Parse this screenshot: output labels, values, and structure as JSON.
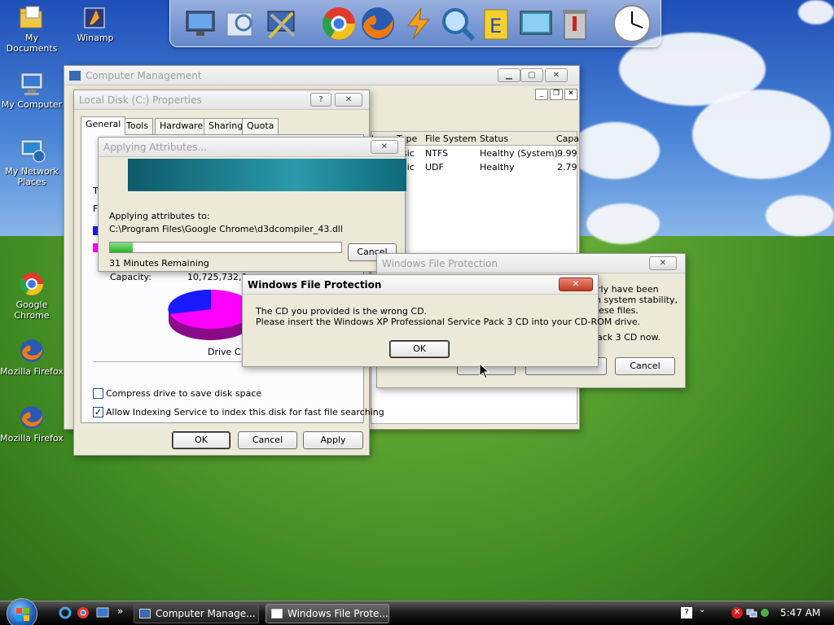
{
  "desktop": {
    "icons": [
      {
        "label": "My Documents"
      },
      {
        "label": "Winamp"
      },
      {
        "label": "My Computer"
      },
      {
        "label": "My Network Places"
      },
      {
        "label": "Google Chrome"
      },
      {
        "label": "Mozilla Firefox"
      },
      {
        "label": "Mozilla Firefox"
      }
    ]
  },
  "dock": {
    "items": [
      "monitor-icon",
      "search-docs-icon",
      "tools-icon",
      "chrome-icon",
      "firefox-icon",
      "winamp-icon",
      "search-icon",
      "file-icon",
      "display-icon",
      "trash-icon",
      "clock-icon"
    ]
  },
  "computer_management": {
    "title": "Computer Management",
    "columns": [
      "t",
      "Type",
      "File System",
      "Status",
      "Capa"
    ],
    "rows": [
      {
        "type": "sic",
        "fs": "NTFS",
        "status": "Healthy (System)",
        "cap": "9.99"
      },
      {
        "type": "sic",
        "fs": "UDF",
        "status": "Healthy",
        "cap": "2.79"
      }
    ]
  },
  "properties": {
    "title": "Local Disk (C:) Properties",
    "tabs": [
      "General",
      "Tools",
      "Hardware",
      "Sharing",
      "Quota"
    ],
    "side_letters": [
      "Ty",
      "Fi"
    ],
    "capacity_label": "Capacity:",
    "capacity_value": "10,725,732,3...",
    "drive_label": "Drive C",
    "compress_label": "Compress drive to save disk space",
    "index_label": "Allow Indexing Service to index this disk for fast file searching",
    "ok": "OK",
    "cancel": "Cancel",
    "apply": "Apply",
    "used_color": "#ff00ff",
    "free_color": "#1a1aff"
  },
  "applying": {
    "title": "Applying Attributes...",
    "text": "Applying attributes to:",
    "path": "C:\\Program Files\\Google Chrome\\d3dcompiler_43.dll",
    "remaining": "31 Minutes Remaining",
    "progress": 0.1,
    "cancel": "Cancel"
  },
  "wfp_back": {
    "title": "Windows File Protection",
    "text1": "rly have been",
    "text2": "n system stability,",
    "text3": "ese files.",
    "text4": "ack 3 CD now.",
    "cancel": "Cancel"
  },
  "wfp_front": {
    "title": "Windows File Protection",
    "line1": "The CD you provided is the wrong CD.",
    "line2": "Please insert the Windows XP Professional Service Pack 3 CD into your CD-ROM drive.",
    "ok": "OK"
  },
  "taskbar": {
    "items": [
      "Computer Manage...",
      "Windows File Prote..."
    ],
    "time": "5:47 AM",
    "chevron": "»"
  }
}
